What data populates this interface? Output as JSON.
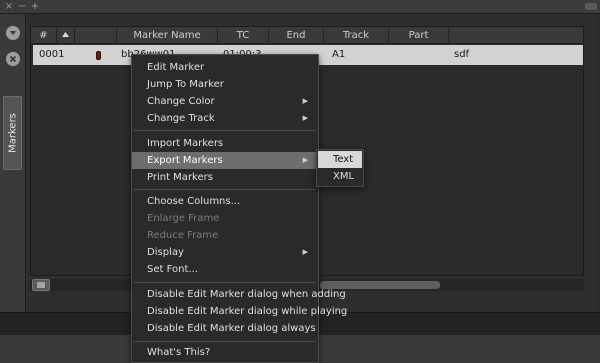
{
  "window": {
    "buttons": [
      "×",
      "−",
      "+"
    ]
  },
  "sidebar": {
    "tab_label": "Markers"
  },
  "table": {
    "columns": [
      "#",
      "Marker Name",
      "TC",
      "End",
      "Track",
      "Part"
    ],
    "rows": [
      {
        "num": "0001",
        "name": "bb26ww01",
        "tc": "01:00:3",
        "end": "",
        "track": "A1",
        "part": "",
        "comment": "sdf"
      }
    ]
  },
  "context_menu": {
    "items": [
      {
        "label": "Edit Marker",
        "enabled": true,
        "submenu": false
      },
      {
        "label": "Jump To Marker",
        "enabled": true,
        "submenu": false
      },
      {
        "label": "Change Color",
        "enabled": true,
        "submenu": true
      },
      {
        "label": "Change Track",
        "enabled": true,
        "submenu": true
      },
      {
        "label": "Import Markers",
        "enabled": true,
        "submenu": false
      },
      {
        "label": "Export Markers",
        "enabled": true,
        "submenu": true,
        "highlighted": true
      },
      {
        "label": "Print Markers",
        "enabled": true,
        "submenu": false
      },
      {
        "label": "Choose Columns...",
        "enabled": true,
        "submenu": false
      },
      {
        "label": "Enlarge Frame",
        "enabled": false,
        "submenu": false
      },
      {
        "label": "Reduce Frame",
        "enabled": false,
        "submenu": false
      },
      {
        "label": "Display",
        "enabled": true,
        "submenu": true
      },
      {
        "label": "Set Font...",
        "enabled": true,
        "submenu": false
      },
      {
        "label": "Disable Edit Marker dialog when adding",
        "enabled": true,
        "submenu": false
      },
      {
        "label": "Disable Edit Marker dialog while playing",
        "enabled": true,
        "submenu": false
      },
      {
        "label": "Disable Edit Marker dialog always",
        "enabled": true,
        "submenu": false
      },
      {
        "label": "What's This?",
        "enabled": true,
        "submenu": false
      }
    ]
  },
  "export_submenu": {
    "items": [
      {
        "label": "Text",
        "highlighted": true
      },
      {
        "label": "XML",
        "highlighted": false
      }
    ]
  },
  "icons": {
    "submenu_arrow": "triangle-right-icon",
    "sort_indicator": "triangle-up-icon",
    "rail_top": "chevron-down-circle-icon",
    "rail_close": "close-circle-icon",
    "list_menu": "hamburger-icon"
  }
}
